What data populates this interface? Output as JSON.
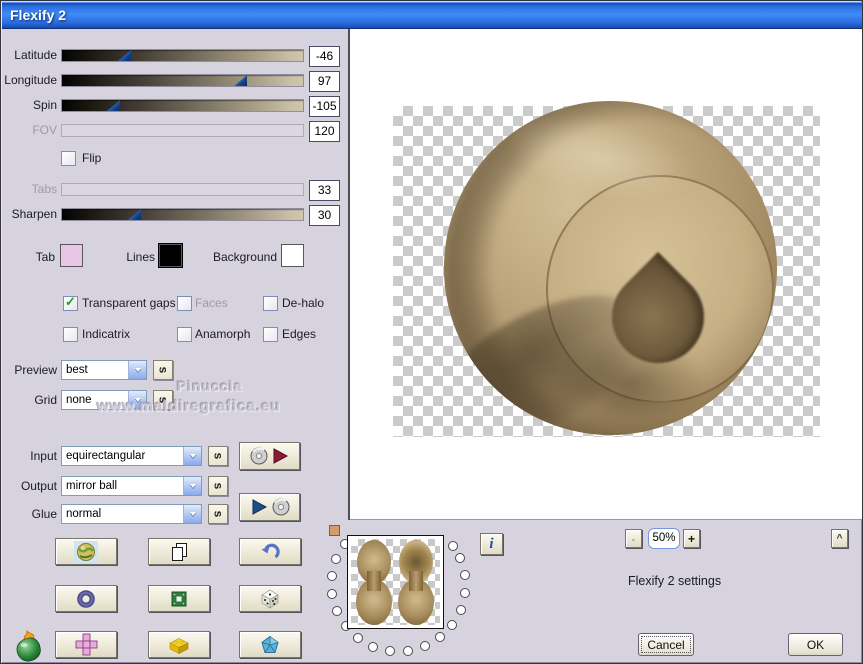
{
  "window": {
    "title": "Flexify 2"
  },
  "sliders": {
    "latitude": {
      "label": "Latitude",
      "value": "-46",
      "disabled": false,
      "thumb_percent": 26
    },
    "longitude": {
      "label": "Longitude",
      "value": "97",
      "disabled": false,
      "thumb_percent": 74
    },
    "spin": {
      "label": "Spin",
      "value": "-105",
      "disabled": false,
      "thumb_percent": 21
    },
    "fov": {
      "label": "FOV",
      "value": "120",
      "disabled": true
    },
    "tabs": {
      "label": "Tabs",
      "value": "33",
      "disabled": true
    },
    "sharpen": {
      "label": "Sharpen",
      "value": "30",
      "disabled": false,
      "thumb_percent": 30
    }
  },
  "checkboxes": {
    "flip": {
      "label": "Flip",
      "checked": false,
      "disabled": false
    },
    "transparent_gaps": {
      "label": "Transparent gaps",
      "checked": true,
      "disabled": false
    },
    "faces": {
      "label": "Faces",
      "checked": false,
      "disabled": true
    },
    "dehalo": {
      "label": "De-halo",
      "checked": false,
      "disabled": false
    },
    "indicatrix": {
      "label": "Indicatrix",
      "checked": false,
      "disabled": false
    },
    "anamorph": {
      "label": "Anamorph",
      "checked": false,
      "disabled": false
    },
    "edges": {
      "label": "Edges",
      "checked": false,
      "disabled": false
    }
  },
  "swatches": {
    "tab": {
      "label": "Tab",
      "color": "#e9c6e4"
    },
    "lines": {
      "label": "Lines",
      "color": "#000000"
    },
    "background": {
      "label": "Background",
      "color": "#ffffff"
    }
  },
  "dropdowns": {
    "preview": {
      "label": "Preview",
      "value": "best"
    },
    "grid": {
      "label": "Grid",
      "value": "none"
    },
    "input": {
      "label": "Input",
      "value": "equirectangular"
    },
    "output": {
      "label": "Output",
      "value": "mirror ball"
    },
    "glue": {
      "label": "Glue",
      "value": "normal"
    }
  },
  "randomize_label": "s",
  "icon_grid": [
    {
      "name": "globe"
    },
    {
      "name": "copy-pages"
    },
    {
      "name": "undo-arrow"
    },
    {
      "name": "ring"
    },
    {
      "name": "green-chip"
    },
    {
      "name": "dice"
    },
    {
      "name": "cube-net"
    },
    {
      "name": "lego-brick"
    },
    {
      "name": "gem"
    }
  ],
  "io_icons": {
    "load": "disc-then-red-play",
    "save": "blue-play-then-disc"
  },
  "dial": {
    "dot_count": 18
  },
  "preview_panel": {
    "zoom_out_label": "-",
    "zoom_level": "50%",
    "zoom_in_label": "+",
    "collapse_label": "^",
    "info_label": "i",
    "status_text": "Flexify 2 settings"
  },
  "watermark": {
    "line1": "Pinuccia",
    "line2": "www.maldiregrafica.eu"
  },
  "actions": {
    "cancel_label": "Cancel",
    "ok_label": "OK"
  },
  "colors": {
    "dialog_bg": "#d6d3de",
    "titlebar_blue": "#2e6fe0",
    "button_face": "#f1eddc",
    "sphere_tan": "#b49b74",
    "check_green": "#1fa11f"
  }
}
